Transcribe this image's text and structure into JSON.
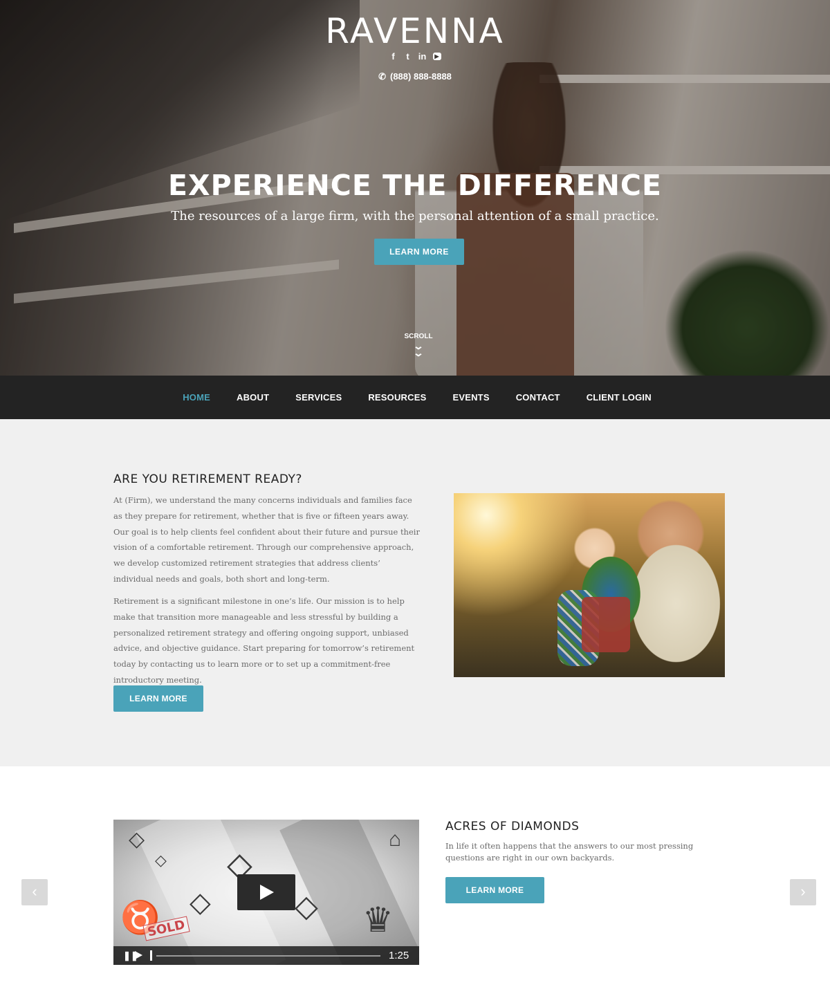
{
  "header": {
    "brand": "RAVENNA",
    "social": [
      {
        "icon": "facebook-icon",
        "glyph": "f"
      },
      {
        "icon": "twitter-icon",
        "glyph": "t"
      },
      {
        "icon": "linkedin-icon",
        "glyph": "in"
      },
      {
        "icon": "youtube-icon",
        "glyph": "▶"
      }
    ],
    "phone_icon": "phone-icon",
    "phone": "(888) 888-8888"
  },
  "hero": {
    "title": "EXPERIENCE THE DIFFERENCE",
    "subtitle": "The resources of a large firm, with the personal attention of a small practice.",
    "button": "LEARN MORE",
    "scroll_label": "SCROLL",
    "scroll_icon": "double-chevron-down-icon"
  },
  "nav": {
    "items": [
      "HOME",
      "ABOUT",
      "SERVICES",
      "RESOURCES",
      "EVENTS",
      "CONTACT",
      "CLIENT LOGIN"
    ],
    "active": "HOME",
    "active_color": "#4aa3b9"
  },
  "retirement": {
    "heading": "ARE YOU RETIREMENT READY?",
    "paragraph1": "At (Firm), we understand the many concerns individuals and families face as they prepare for retirement, whether that is five or fifteen years away. Our goal is to help clients feel confident about their future and pursue their vision of a comfortable retirement. Through our comprehensive approach, we develop customized retirement strategies that address clients’ individual needs and goals, both short and long-term.",
    "paragraph2": "Retirement is a significant milestone in one’s life. Our mission is to help make that transition more manageable and less stressful by building a personalized retirement strategy and offering ongoing support, unbiased advice, and objective guidance. Start preparing for tomorrow’s retirement today by contacting us to learn more or to set up a commitment-free introductory meeting.",
    "button": "LEARN MORE"
  },
  "feature": {
    "heading": "ACRES OF DIAMONDS",
    "description": "In life it often happens that the answers to our most pressing questions are right in our own backyards.",
    "button": "LEARN MORE",
    "video": {
      "sold_label": "SOLD",
      "time": "1:25",
      "play_icon": "play-icon",
      "pause_icon": "pause-icon"
    },
    "prev_icon": "chevron-left-icon",
    "next_icon": "chevron-right-icon"
  },
  "colors": {
    "accent": "#4aa3b9",
    "nav_bg": "#232323",
    "section_bg": "#f0f0f0"
  }
}
